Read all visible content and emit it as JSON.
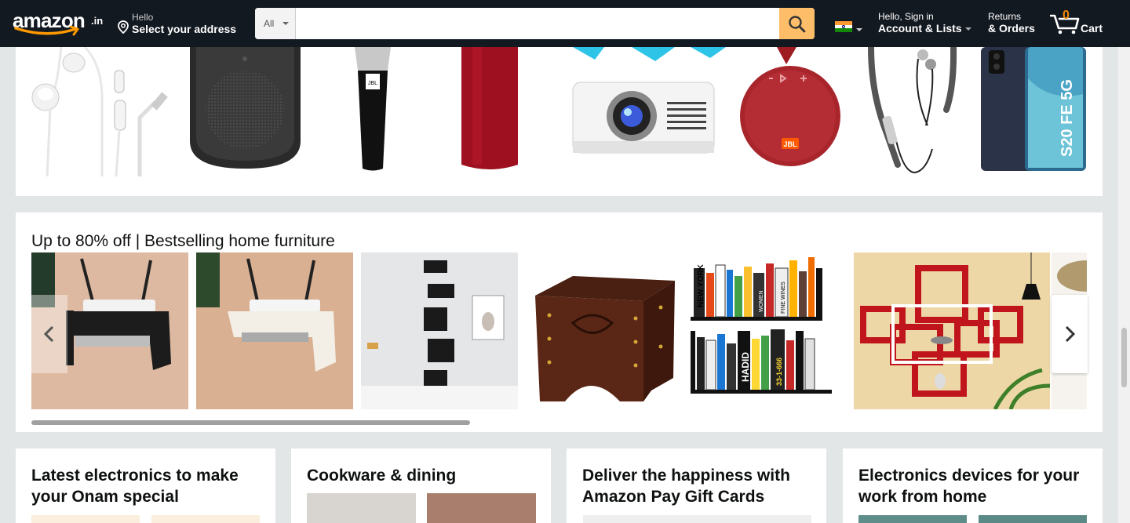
{
  "nav": {
    "logo_text": "amazon",
    "logo_tld": ".in",
    "address_hello": "Hello",
    "address_label": "Select your address",
    "search_category": "All",
    "search_placeholder": "",
    "account_hello": "Hello, Sign in",
    "account_label": "Account & Lists",
    "returns_line1": "Returns",
    "returns_line2": "& Orders",
    "cart_count": "0",
    "cart_label": "Cart"
  },
  "strip1": {
    "products": [
      {
        "icon": "earphones-icon"
      },
      {
        "icon": "bluetooth-speaker-icon"
      },
      {
        "icon": "microphone-icon"
      },
      {
        "icon": "cylinder-speaker-icon"
      },
      {
        "icon": "projector-icon"
      },
      {
        "icon": "jbl-speaker-icon",
        "brand": "JBL"
      },
      {
        "icon": "neckband-icon"
      },
      {
        "icon": "smartphone-icon",
        "label": "S20 FE 5G"
      }
    ]
  },
  "furniture": {
    "title": "Up to 80% off | Bestselling home furniture",
    "items": [
      {
        "icon": "wifi-router-shelf-black-icon"
      },
      {
        "icon": "wifi-router-shelf-white-icon"
      },
      {
        "icon": "corner-wall-shelf-icon"
      },
      {
        "icon": "wooden-side-table-icon"
      },
      {
        "icon": "bookshelf-icon",
        "texts": [
          "NEW YORK",
          "FINE WINES",
          "WOMEN",
          "HADID",
          "33-1-666"
        ]
      },
      {
        "icon": "red-wall-shelf-icon"
      },
      {
        "icon": "side-table-partial-icon"
      }
    ]
  },
  "grid_cards": [
    {
      "title": "Latest electronics to make your Onam special"
    },
    {
      "title": "Cookware & dining"
    },
    {
      "title": "Deliver the happiness with Amazon Pay Gift Cards"
    },
    {
      "title": "Electronics devices for your work from home"
    }
  ],
  "colors": {
    "nav_bg": "#131921",
    "search_button": "#febd69",
    "cart_count": "#f08804",
    "page_bg": "#e3e6e6"
  }
}
